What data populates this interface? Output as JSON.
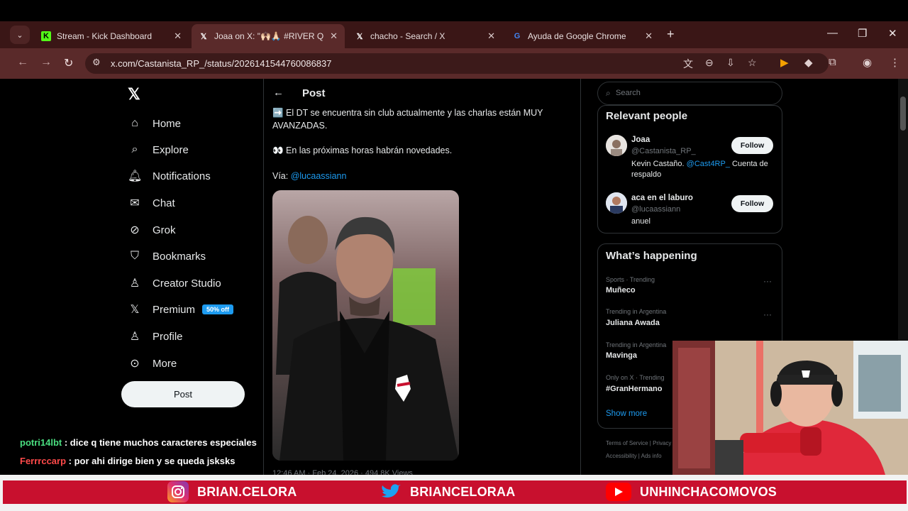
{
  "browser": {
    "tabs": [
      {
        "title": "Stream - Kick Dashboard",
        "favicon": "kick-icon",
        "active": false
      },
      {
        "title": "Joaa on X: \"🙌🏻🙏🏻 #RIVER QUIER",
        "favicon": "x-icon",
        "active": true
      },
      {
        "title": "chacho - Search / X",
        "favicon": "x-icon",
        "active": false
      },
      {
        "title": "Ayuda de Google Chrome",
        "favicon": "google-icon",
        "active": false
      }
    ],
    "url": "x.com/Castanista_RP_/status/2026141544760086837"
  },
  "sidebar": {
    "items": [
      {
        "label": "Home",
        "icon": "home-icon"
      },
      {
        "label": "Explore",
        "icon": "search-icon"
      },
      {
        "label": "Notifications",
        "icon": "bell-icon"
      },
      {
        "label": "Chat",
        "icon": "mail-icon"
      },
      {
        "label": "Grok",
        "icon": "grok-icon"
      },
      {
        "label": "Bookmarks",
        "icon": "bookmark-icon"
      },
      {
        "label": "Creator Studio",
        "icon": "creator-studio-icon"
      },
      {
        "label": "Premium",
        "icon": "x-icon",
        "badge": "50% off"
      },
      {
        "label": "Profile",
        "icon": "person-icon"
      },
      {
        "label": "More",
        "icon": "more-icon"
      }
    ],
    "post_button": "Post"
  },
  "post": {
    "header": "Post",
    "line1": "➡️ El DT se encuentra sin club actualmente y las charlas están MUY AVANZADAS.",
    "line2": "👀 En las próximas horas habrán novedades.",
    "via_label": "Vía: ",
    "via_link": "@lucaassiann",
    "meta": "12:46 AM · Feb 24, 2026 · 494.8K Views"
  },
  "right": {
    "search_placeholder": "Search",
    "relevant_title": "Relevant people",
    "people": [
      {
        "name": "Joaa",
        "handle": "@Castanista_RP_",
        "bio_prefix": "Kevin Castaño. ",
        "bio_link": "@Cast4RP_",
        "bio_suffix": " Cuenta de respaldo",
        "follow": "Follow"
      },
      {
        "name": "aca en el laburo",
        "handle": "@lucaassiann",
        "bio_prefix": "anuel",
        "bio_link": "",
        "bio_suffix": "",
        "follow": "Follow"
      }
    ],
    "happening_title": "What’s happening",
    "trends": [
      {
        "context": "Sports · Trending",
        "name": "Muñeco"
      },
      {
        "context": "Trending in Argentina",
        "name": "Juliana Awada"
      },
      {
        "context": "Trending in Argentina",
        "name": "Mavinga"
      },
      {
        "context": "Only on X · Trending",
        "name": "#GranHermano"
      }
    ],
    "show_more": "Show more",
    "footer_line1": "Terms of Service   |   Privacy",
    "footer_line2": "Accessibility   |   Ads info"
  },
  "chat": [
    {
      "user": "potri14lbt",
      "text": " : dice q tiene muchos caracteres especiales"
    },
    {
      "user": "Ferrrccarp",
      "text": " : por ahi dirige bien y se queda jsksks"
    }
  ],
  "banner": {
    "instagram": "BRIAN.CELORA",
    "twitter": "BRIANCELORAA",
    "youtube": "UNHINCHACOMOVOS"
  },
  "colors": {
    "accent": "#1d9bf0",
    "browser_frame": "#5a2a2a",
    "banner_red": "#c8102e"
  }
}
